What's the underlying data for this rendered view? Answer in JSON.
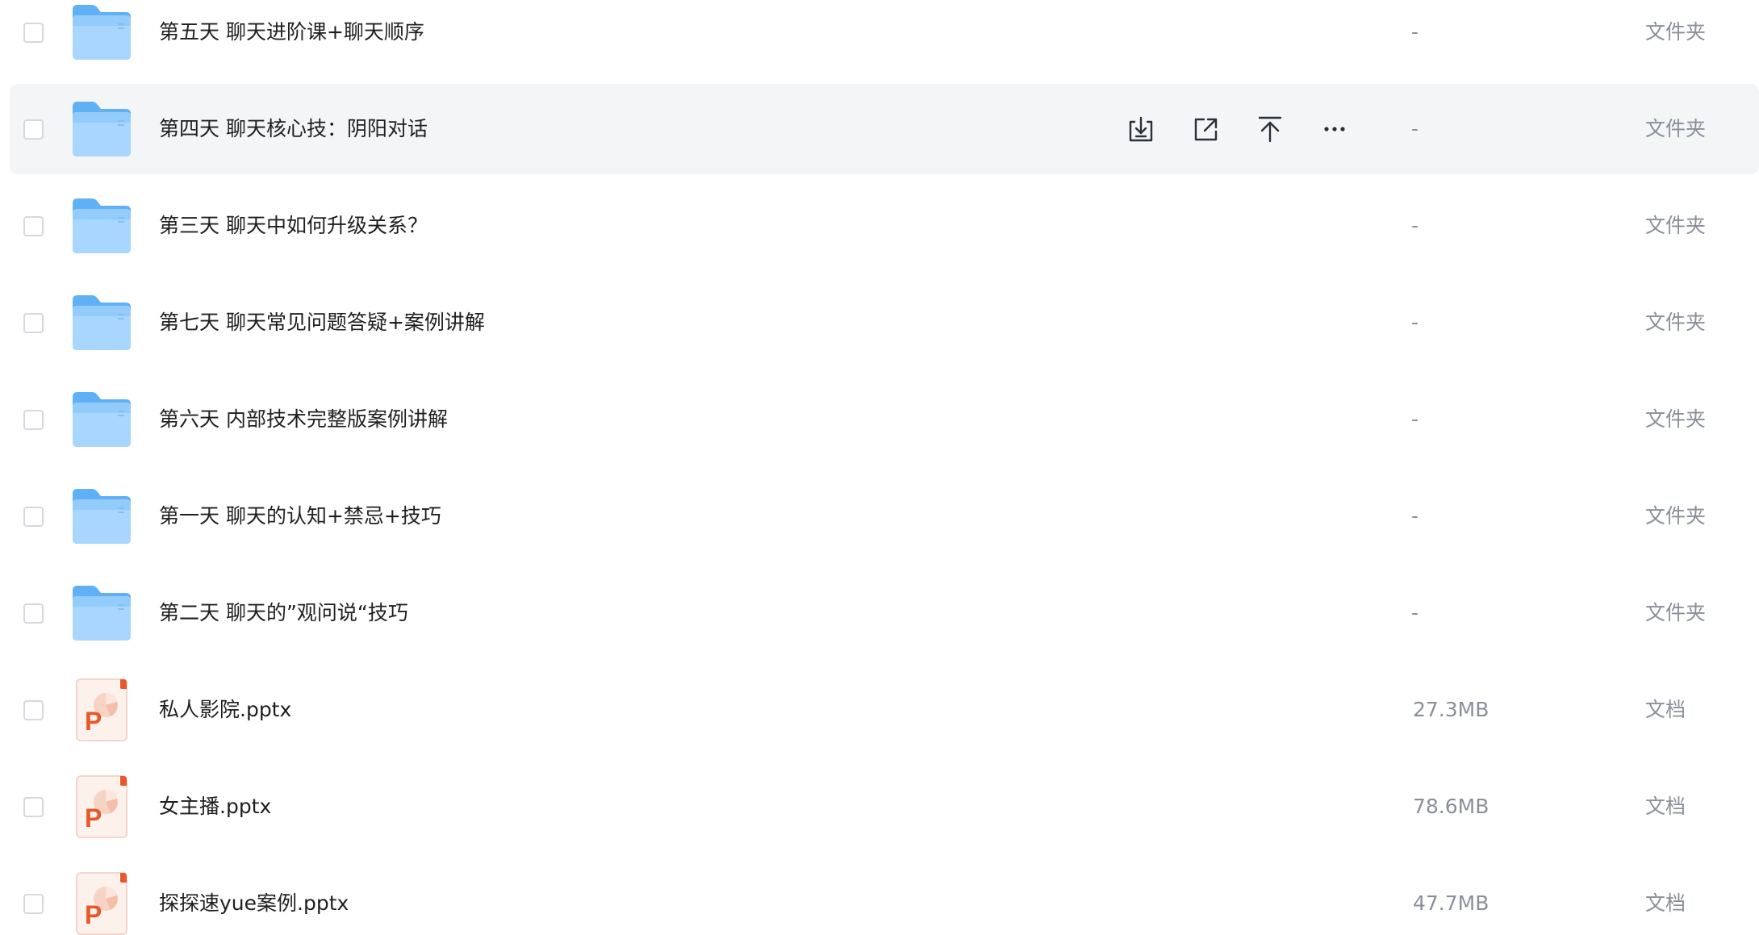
{
  "files": [
    {
      "name": "第五天 聊天进阶课+聊天顺序",
      "size": "-",
      "type": "文件夹",
      "icon": "folder-icon"
    },
    {
      "name": "第四天 聊天核心技：阴阳对话",
      "size": "-",
      "type": "文件夹",
      "icon": "folder-icon"
    },
    {
      "name": "第三天 聊天中如何升级关系？",
      "size": "-",
      "type": "文件夹",
      "icon": "folder-icon"
    },
    {
      "name": "第七天 聊天常见问题答疑+案例讲解",
      "size": "-",
      "type": "文件夹",
      "icon": "folder-icon"
    },
    {
      "name": "第六天 内部技术完整版案例讲解",
      "size": "-",
      "type": "文件夹",
      "icon": "folder-icon"
    },
    {
      "name": "第一天 聊天的认知+禁忌+技巧",
      "size": "-",
      "type": "文件夹",
      "icon": "folder-icon"
    },
    {
      "name": "第二天 聊天的”观问说“技巧",
      "size": "-",
      "type": "文件夹",
      "icon": "folder-icon"
    },
    {
      "name": "私人影院.pptx",
      "size": "27.3MB",
      "type": "文档",
      "icon": "pptx-file-icon"
    },
    {
      "name": "女主播.pptx",
      "size": "78.6MB",
      "type": "文档",
      "icon": "pptx-file-icon"
    },
    {
      "name": "探探速yue案例.pptx",
      "size": "47.7MB",
      "type": "文档",
      "icon": "pptx-file-icon"
    }
  ],
  "hovered_row_index": 1,
  "row_actions": [
    "download-icon",
    "share-icon",
    "move-to-top-icon",
    "more-icon"
  ],
  "colors": {
    "folder_light": "#a9d6ff",
    "folder_dark": "#5fb0f5",
    "pptx_accent": "#e8572c",
    "hover_bg": "#f4f5f7",
    "muted_text": "#8a8f99"
  }
}
